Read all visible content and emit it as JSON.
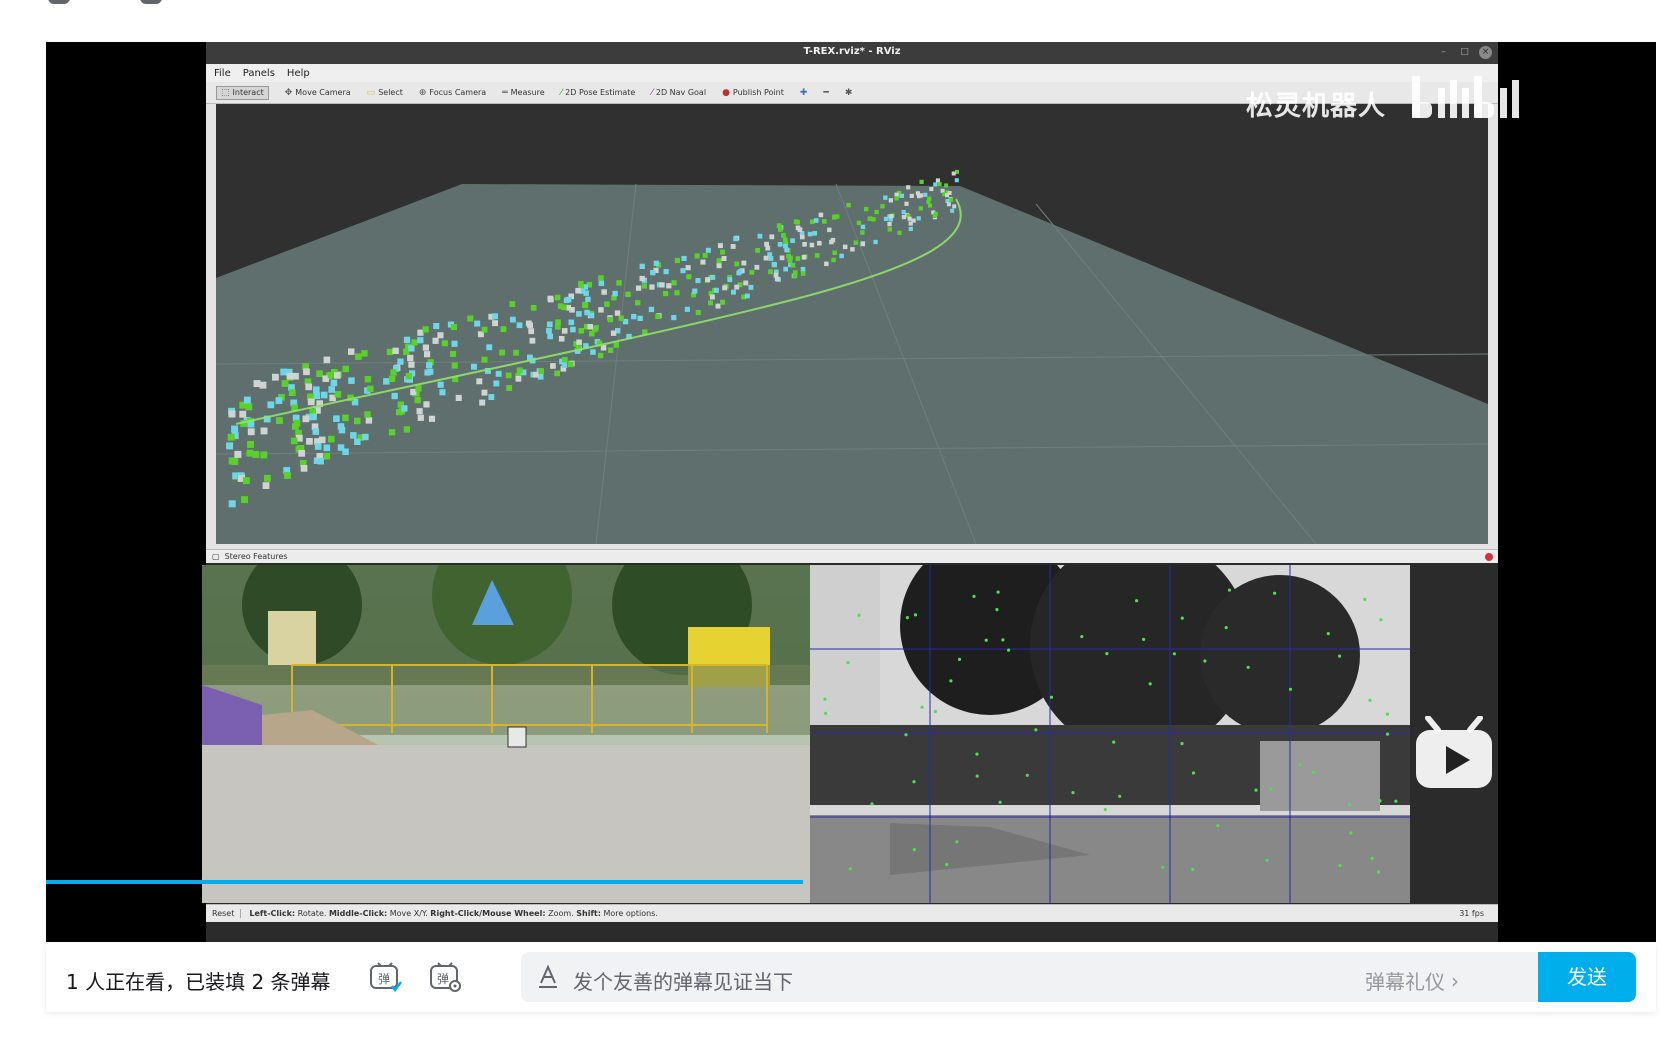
{
  "player": {
    "rviz": {
      "title": "T-REX.rviz* - RViz",
      "menu": [
        "File",
        "Panels",
        "Help"
      ],
      "tools": [
        {
          "label": "Interact",
          "icon": "cursor-icon",
          "active": true
        },
        {
          "label": "Move Camera",
          "icon": "move-camera-icon",
          "active": false
        },
        {
          "label": "Select",
          "icon": "select-icon",
          "active": false
        },
        {
          "label": "Focus Camera",
          "icon": "focus-icon",
          "active": false
        },
        {
          "label": "Measure",
          "icon": "measure-icon",
          "active": false
        },
        {
          "label": "2D Pose Estimate",
          "icon": "pose-arrow-icon",
          "active": false
        },
        {
          "label": "2D Nav Goal",
          "icon": "nav-arrow-icon",
          "active": false
        },
        {
          "label": "Publish Point",
          "icon": "pin-icon",
          "active": false
        }
      ],
      "panel_title": "Stereo Features",
      "status": {
        "reset": "Reset",
        "hint_parts": [
          {
            "bold": "Left-Click:",
            "text": " Rotate. "
          },
          {
            "bold": "Middle-Click:",
            "text": " Move X/Y. "
          },
          {
            "bold": "Right-Click/Mouse Wheel:",
            "text": " Zoom. "
          },
          {
            "bold": "Shift:",
            "text": " More options."
          }
        ],
        "fps": "31 fps"
      }
    },
    "watermark": {
      "text": "松灵机器人",
      "logo": "bilibili"
    },
    "progress": 0.47
  },
  "danmaku": {
    "viewers": "1 人正在看，已装填 2 条弹幕",
    "placeholder": "发个友善的弹幕见证当下",
    "etiquette": "弹幕礼仪",
    "send": "发送"
  },
  "colors": {
    "accent": "#00aeec",
    "voxel_green": "#5ad12a",
    "voxel_cyan": "#6fd6e8",
    "map_plane": "#5f6f6d"
  }
}
